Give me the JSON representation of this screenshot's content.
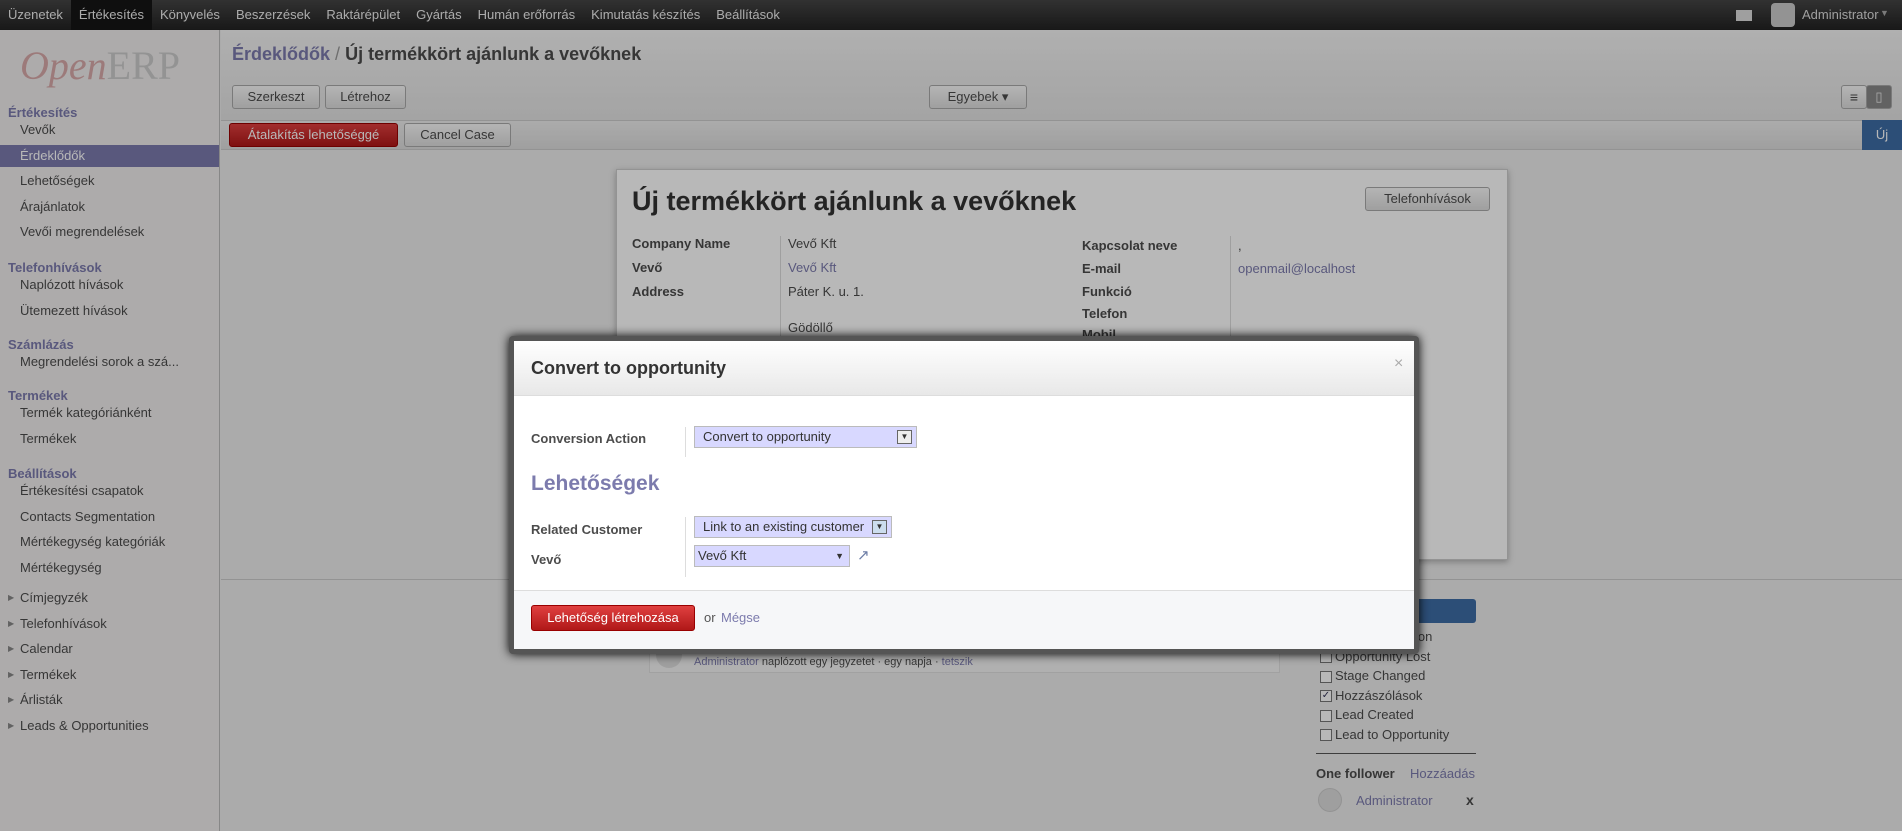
{
  "topbar": {
    "menus": [
      "Üzenetek",
      "Értékesítés",
      "Könyvelés",
      "Beszerzések",
      "Raktárépület",
      "Gyártás",
      "Humán erőforrás",
      "Kimutatás készítés",
      "Beállítások"
    ],
    "active": 1,
    "user": "Administrator"
  },
  "logo": {
    "open": "Open",
    "erp": "ERP"
  },
  "sidebar": {
    "s1": "Értékesítés",
    "s1_items": [
      "Vevők",
      "Érdeklődők",
      "Lehetőségek",
      "Árajánlatok",
      "Vevői megrendelések"
    ],
    "s2": "Telefonhívások",
    "s2_items": [
      "Naplózott hívások",
      "Ütemezett hívások"
    ],
    "s3": "Számlázás",
    "s3_items": [
      "Megrendelési sorok a szá..."
    ],
    "s4": "Termékek",
    "s4_items": [
      "Termék kategóriánként",
      "Termékek"
    ],
    "s5": "Beállítások",
    "s5_items": [
      "Értékesítési csapatok",
      "Contacts Segmentation",
      "Mértékegység kategóriák",
      "Mértékegység"
    ],
    "collapsed": [
      "Címjegyzék",
      "Telefonhívások",
      "Calendar",
      "Termékek",
      "Árlisták",
      "Leads & Opportunities"
    ]
  },
  "breadcrumb": {
    "parent": "Érdeklődők",
    "sep": "/",
    "current": "Új termékkört ajánlunk a vevőknek"
  },
  "toolbar": {
    "edit": "Szerkeszt",
    "create": "Létrehoz",
    "more": "Egyebek ▾"
  },
  "statusbar": {
    "convert": "Átalakítás lehetőséggé",
    "cancel": "Cancel Case",
    "stage": "Új"
  },
  "form": {
    "title": "Új termékkört ajánlunk a vevőknek",
    "calls_button": "Telefonhívások",
    "left": [
      {
        "label": "Company Name",
        "value": "Vevő Kft"
      },
      {
        "label": "Vevő",
        "value": "Vevő Kft"
      },
      {
        "label": "Address",
        "value": "Páter K. u. 1."
      }
    ],
    "city": "Gödöllő",
    "right": [
      {
        "label": "Kapcsolat neve",
        "value": ","
      },
      {
        "label": "E-mail",
        "value": "openmail@localhost"
      },
      {
        "label": "Funkció",
        "value": ""
      },
      {
        "label": "Telefon",
        "value": ""
      },
      {
        "label": "Mobil",
        "value": ""
      }
    ]
  },
  "chatter": {
    "message": {
      "author": "Administrator",
      "text": "naplózott egy jegyzetet",
      "time": "egy napja",
      "like": "tetszik"
    },
    "subtypes": [
      {
        "label": "Opportunity Won",
        "checked": false
      },
      {
        "label": "Opportunity Lost",
        "checked": false
      },
      {
        "label": "Stage Changed",
        "checked": false
      },
      {
        "label": "Hozzászólások",
        "checked": true
      },
      {
        "label": "Lead Created",
        "checked": false
      },
      {
        "label": "Lead to Opportunity",
        "checked": false
      }
    ],
    "followers_title": "One follower",
    "add": "Hozzáadás",
    "follower": "Administrator",
    "remove": "x"
  },
  "modal": {
    "title": "Convert to opportunity",
    "close": "×",
    "conversion_label": "Conversion Action",
    "conversion_value": "Convert to opportunity",
    "section": "Lehetőségek",
    "related_label": "Related Customer",
    "related_value": "Link to an existing customer",
    "customer_label": "Vevő",
    "customer_value": "Vevő Kft",
    "submit": "Lehetőség létrehozása",
    "or": "or",
    "cancel": "Mégse"
  }
}
